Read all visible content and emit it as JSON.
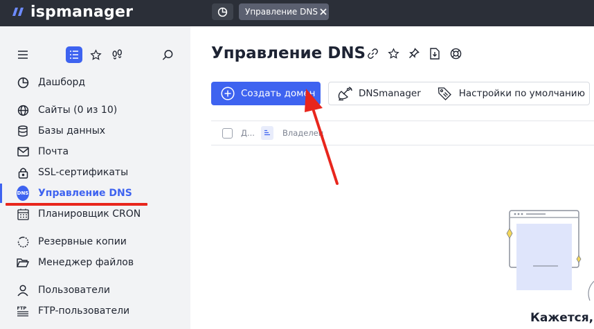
{
  "app": {
    "logo_text": "ispmanager",
    "tab_label": "Управление DNS"
  },
  "colors": {
    "accent": "#3e63f0",
    "topbar": "#2b2f38",
    "sidebar": "#f2f3f5",
    "annotation": "#e8261d"
  },
  "sidebar": {
    "tools": [
      {
        "name": "menu-icon"
      },
      {
        "name": "list-icon",
        "active": true
      },
      {
        "name": "star-icon"
      },
      {
        "name": "footprints-icon"
      },
      {
        "name": "search-icon"
      }
    ],
    "items": [
      {
        "label": "Дашборд",
        "icon": "dashboard-icon"
      },
      {
        "label": "Сайты (0 из 10)",
        "icon": "globe-icon"
      },
      {
        "label": "Базы данных",
        "icon": "database-icon"
      },
      {
        "label": "Почта",
        "icon": "mail-icon"
      },
      {
        "label": "SSL-сертификаты",
        "icon": "lock-icon"
      },
      {
        "label": "Управление DNS",
        "icon": "dns-icon",
        "active": true
      },
      {
        "label": "Планировщик CRON",
        "icon": "calendar-icon"
      },
      {
        "label": "Резервные копии",
        "icon": "backup-icon"
      },
      {
        "label": "Менеджер файлов",
        "icon": "folder-icon"
      },
      {
        "label": "Пользователи",
        "icon": "user-icon"
      },
      {
        "label": "FTP-пользователи",
        "icon": "ftp-icon"
      }
    ],
    "dns_badge": "DNS",
    "ftp_badge": "FTP"
  },
  "main": {
    "title": "Управление DNS",
    "title_icons": [
      "link-icon",
      "star-icon",
      "pin-icon",
      "download-icon",
      "help-icon"
    ],
    "create_button": "Создать домен",
    "dnsmanager_button": "DNSmanager",
    "defaults_button": "Настройки по умолчанию",
    "columns": [
      "Д...",
      "Владелец"
    ],
    "empty_text": "Кажется, с"
  }
}
